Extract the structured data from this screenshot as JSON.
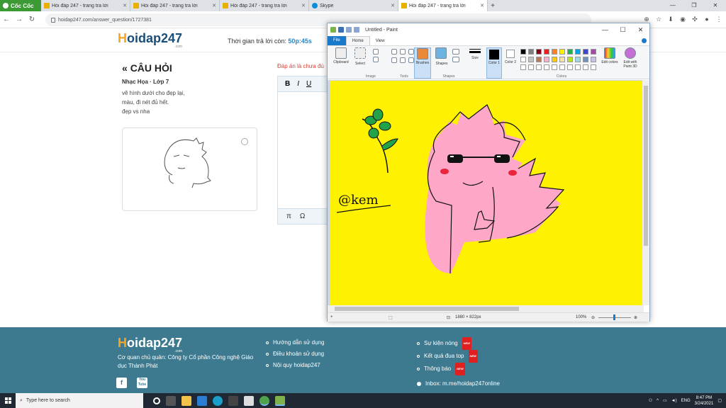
{
  "browser": {
    "brand": "Cốc Cốc",
    "tabs": [
      {
        "title": "Hỏi đáp 247 - trang tra lời",
        "active": false
      },
      {
        "title": "Hỏi đáp 247 - trang tra lời",
        "active": false
      },
      {
        "title": "Hỏi đáp 247 - trang tra lời",
        "active": false
      },
      {
        "title": "Skype",
        "active": false
      },
      {
        "title": "Hỏi đáp 247 - trang tra lời",
        "active": true
      }
    ],
    "url": "hoidap247.com/answer_question/1727381"
  },
  "site": {
    "logo_h": "H",
    "logo_rest": "oidap247",
    "logo_com": ".com",
    "timer_label": "Thời gian trả lời còn:",
    "timer_value": "50p:45s"
  },
  "question": {
    "title": "CÂU HỎI",
    "title_icon": "«",
    "meta": "Nhạc Họa · Lớp 7",
    "lines": [
      "vẽ hình dưới cho đẹp lại,",
      "màu, đi nét đủ hết.",
      "đẹp vs nha"
    ]
  },
  "answer": {
    "label": "Đáp án là chưa đú",
    "toolbar": [
      "B",
      "I",
      "U"
    ],
    "bottom": [
      "π",
      "Ω"
    ]
  },
  "paint": {
    "title": "Untitled - Paint",
    "tabs": {
      "file": "File",
      "home": "Home",
      "view": "View"
    },
    "groups": {
      "clipboard": "Clipboard",
      "select": "Select",
      "image": "Image",
      "tools": "Tools",
      "brushes": "Brushes",
      "shapes_btn": "Shapes",
      "shapes": "Shapes",
      "size": "Size",
      "color1": "Color 1",
      "color2": "Color 2",
      "colors": "Colors",
      "edit_colors": "Edit colors",
      "edit_paint3d": "Edit with Paint 3D"
    },
    "palette": [
      "#000000",
      "#7f7f7f",
      "#880015",
      "#ed1c24",
      "#ff7f27",
      "#fff200",
      "#22b14c",
      "#00a2e8",
      "#3f48cc",
      "#a349a4",
      "#ffffff",
      "#c3c3c3",
      "#b97a57",
      "#ffaec9",
      "#ffc90e",
      "#efe4b0",
      "#b5e61d",
      "#99d9ea",
      "#7092be",
      "#c8bfe7"
    ],
    "canvas_color": "#fff200",
    "signature": "@kem",
    "status_size": "1880 × 822px",
    "zoom": "100%"
  },
  "footer": {
    "logo_h": "H",
    "logo_rest": "oidap247",
    "logo_com": ".com",
    "org": "Cơ quan chủ quản: Công ty Cổ phần Công nghệ Giáo dục Thành Phát",
    "links_col1": [
      "Hướng dẫn sử dụng",
      "Điều khoản sử dụng",
      "Nội quy hoidap247"
    ],
    "links_col2": [
      {
        "label": "Sự kiện nóng",
        "badge": "NEW"
      },
      {
        "label": "Kết quả đua top",
        "badge": "NEW"
      },
      {
        "label": "Thông báo",
        "badge": "NEW"
      }
    ],
    "inbox": "Inbox: m.me/hoidap247online",
    "social": {
      "facebook": "f",
      "youtube": "You Tube"
    }
  },
  "taskbar": {
    "search_placeholder": "Type here to search",
    "lang": "ENG",
    "time": "8:47 PM",
    "date": "3/24/2021"
  }
}
